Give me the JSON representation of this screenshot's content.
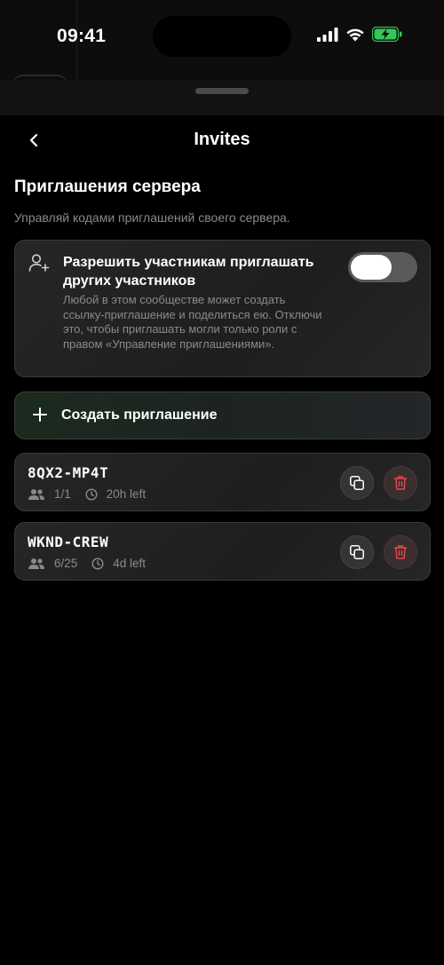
{
  "status_bar": {
    "time": "09:41"
  },
  "nav": {
    "title": "Invites"
  },
  "section": {
    "title": "Приглашения сервера",
    "description": "Управляй кодами приглашений своего сервера."
  },
  "permission": {
    "icon": "user-plus-icon",
    "title": "Разрешить участникам приглашать других участников",
    "description": "Любой в этом сообществе может создать ссылку-приглашение и поделиться ею. Отключи это, чтобы приглашать могли только роли с правом «Управление приглашениями».",
    "enabled": true
  },
  "create": {
    "label": "Создать приглашение",
    "icon": "plus-icon"
  },
  "invites": [
    {
      "code": "8QX2-MP4T",
      "uses": "1/1",
      "expires": "20h left"
    },
    {
      "code": "WKND-CREW",
      "uses": "6/25",
      "expires": "4d left"
    }
  ],
  "colors": {
    "background": "#000000",
    "card": "#222222",
    "delete": "#e0484f",
    "battery": "#33c759"
  }
}
